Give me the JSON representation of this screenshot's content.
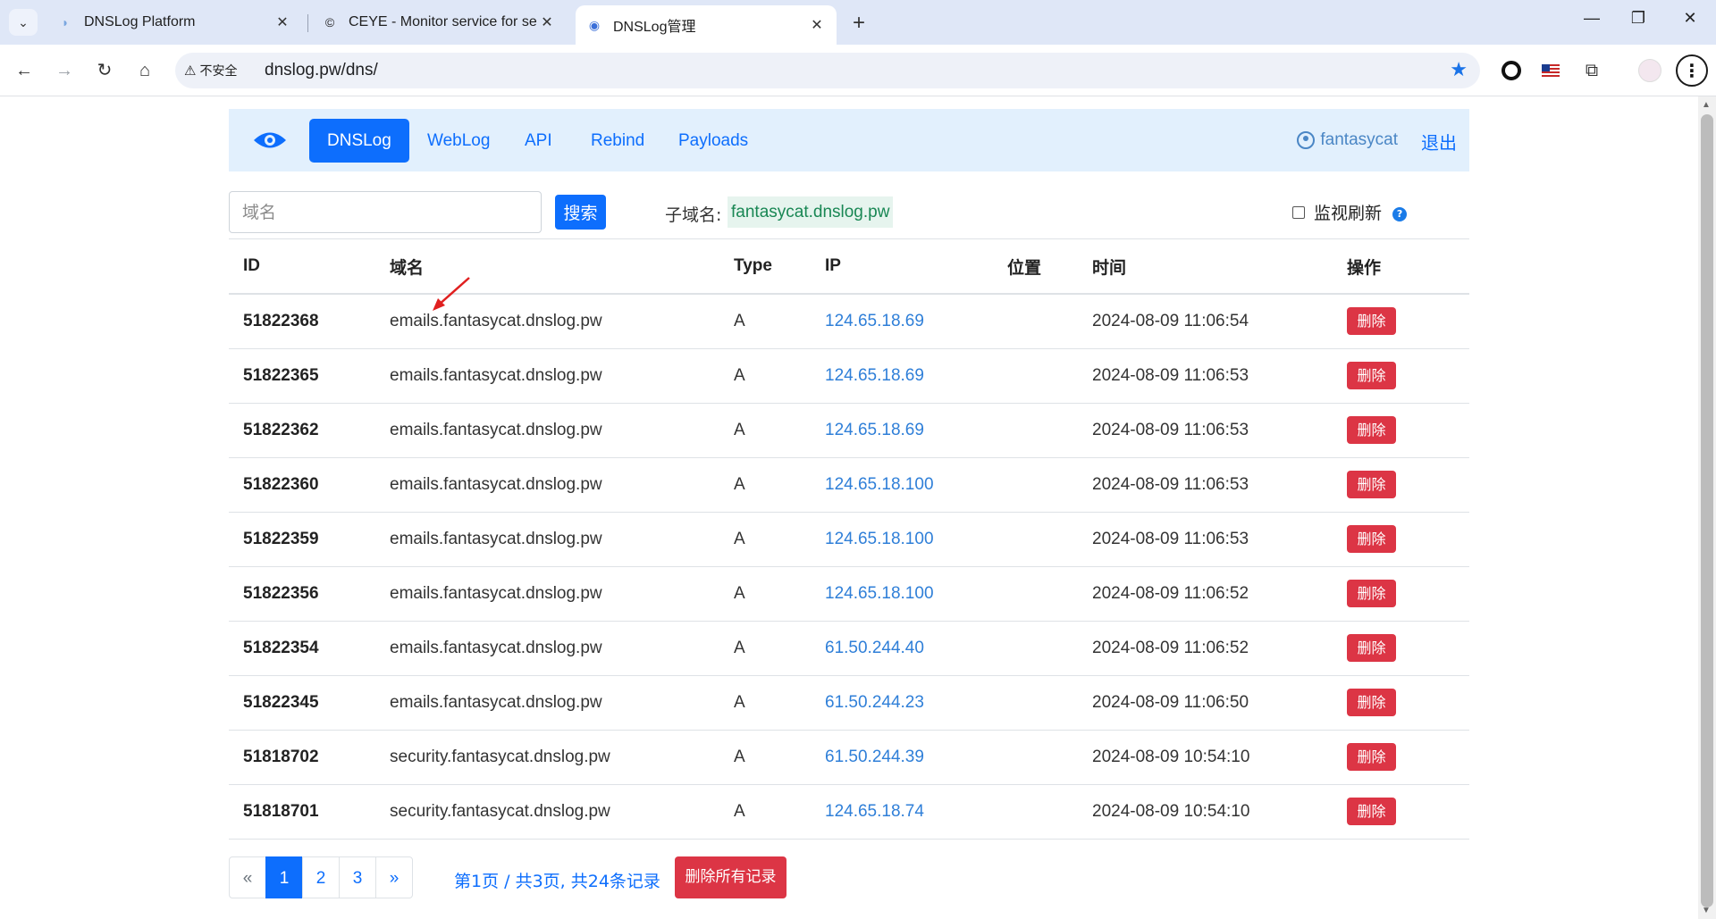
{
  "browser": {
    "tabs": [
      {
        "title": "DNSLog Platform",
        "active": false
      },
      {
        "title": "CEYE - Monitor service for se",
        "active": false
      },
      {
        "title": "DNSLog管理",
        "active": true
      }
    ],
    "security_label": "不安全",
    "url": "dnslog.pw/dns/"
  },
  "nav": {
    "items": [
      "DNSLog",
      "WebLog",
      "API",
      "Rebind",
      "Payloads"
    ],
    "active": "DNSLog",
    "username": "fantasycat",
    "logout": "退出"
  },
  "search": {
    "placeholder": "域名",
    "button": "搜索",
    "subdomain_label": "子域名:",
    "subdomain_value": "fantasycat.dnslog.pw",
    "monitor_label": "监视刷新",
    "help": "?"
  },
  "table": {
    "headers": [
      "ID",
      "域名",
      "Type",
      "IP",
      "位置",
      "时间",
      "操作"
    ],
    "rows": [
      {
        "id": "51822368",
        "domain": "emails.fantasycat.dnslog.pw",
        "type": "A",
        "ip": "124.65.18.69",
        "location": "",
        "time": "2024-08-09 11:06:54",
        "action": "删除"
      },
      {
        "id": "51822365",
        "domain": "emails.fantasycat.dnslog.pw",
        "type": "A",
        "ip": "124.65.18.69",
        "location": "",
        "time": "2024-08-09 11:06:53",
        "action": "删除"
      },
      {
        "id": "51822362",
        "domain": "emails.fantasycat.dnslog.pw",
        "type": "A",
        "ip": "124.65.18.69",
        "location": "",
        "time": "2024-08-09 11:06:53",
        "action": "删除"
      },
      {
        "id": "51822360",
        "domain": "emails.fantasycat.dnslog.pw",
        "type": "A",
        "ip": "124.65.18.100",
        "location": "",
        "time": "2024-08-09 11:06:53",
        "action": "删除"
      },
      {
        "id": "51822359",
        "domain": "emails.fantasycat.dnslog.pw",
        "type": "A",
        "ip": "124.65.18.100",
        "location": "",
        "time": "2024-08-09 11:06:53",
        "action": "删除"
      },
      {
        "id": "51822356",
        "domain": "emails.fantasycat.dnslog.pw",
        "type": "A",
        "ip": "124.65.18.100",
        "location": "",
        "time": "2024-08-09 11:06:52",
        "action": "删除"
      },
      {
        "id": "51822354",
        "domain": "emails.fantasycat.dnslog.pw",
        "type": "A",
        "ip": "61.50.244.40",
        "location": "",
        "time": "2024-08-09 11:06:52",
        "action": "删除"
      },
      {
        "id": "51822345",
        "domain": "emails.fantasycat.dnslog.pw",
        "type": "A",
        "ip": "61.50.244.23",
        "location": "",
        "time": "2024-08-09 11:06:50",
        "action": "删除"
      },
      {
        "id": "51818702",
        "domain": "security.fantasycat.dnslog.pw",
        "type": "A",
        "ip": "61.50.244.39",
        "location": "",
        "time": "2024-08-09 10:54:10",
        "action": "删除"
      },
      {
        "id": "51818701",
        "domain": "security.fantasycat.dnslog.pw",
        "type": "A",
        "ip": "124.65.18.74",
        "location": "",
        "time": "2024-08-09 10:54:10",
        "action": "删除"
      }
    ]
  },
  "pagination": {
    "prev": "«",
    "pages": [
      "1",
      "2",
      "3"
    ],
    "current": "1",
    "next": "»",
    "info": "第1页 / 共3页, 共24条记录",
    "delete_all": "删除所有记录"
  },
  "colors": {
    "primary": "#0d6efd",
    "danger": "#dc3545",
    "navbar_bg": "#e2f0fd",
    "success_text": "#198754",
    "annotation_arrow": "#e02020"
  }
}
